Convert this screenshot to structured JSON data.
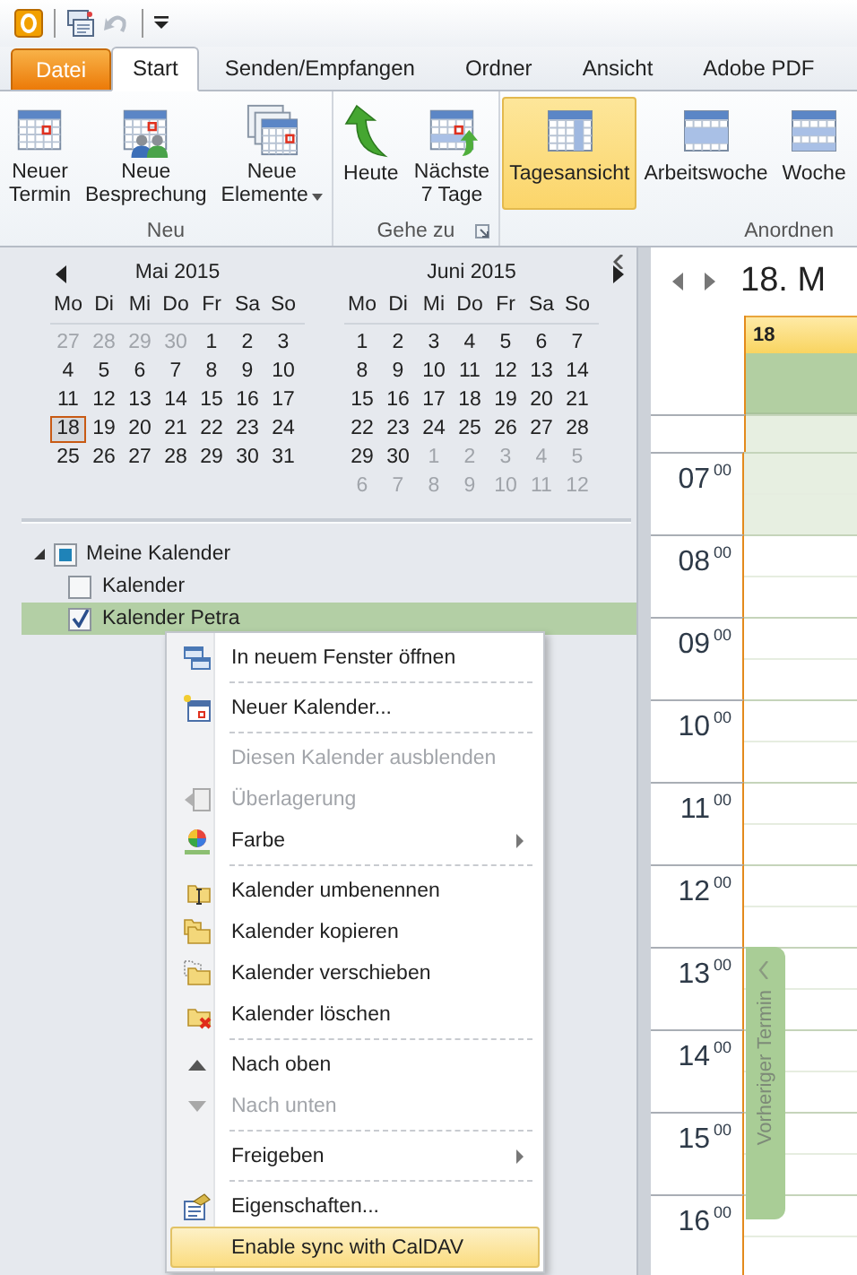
{
  "tabs": [
    {
      "label": "Datei",
      "kind": "file",
      "selected": false
    },
    {
      "label": "Start",
      "kind": "tab",
      "selected": true
    },
    {
      "label": "Senden/Empfangen",
      "kind": "tab",
      "selected": false
    },
    {
      "label": "Ordner",
      "kind": "tab",
      "selected": false
    },
    {
      "label": "Ansicht",
      "kind": "tab",
      "selected": false
    },
    {
      "label": "Adobe PDF",
      "kind": "tab",
      "selected": false
    }
  ],
  "ribbon": {
    "groups": [
      {
        "label": "Neu",
        "buttons": [
          {
            "lines": [
              "Neuer",
              "Termin"
            ],
            "selected": false
          },
          {
            "lines": [
              "Neue",
              "Besprechung"
            ],
            "selected": false
          },
          {
            "lines": [
              "Neue",
              "Elemente"
            ],
            "dropdown": true,
            "selected": false
          }
        ]
      },
      {
        "label": "Gehe zu",
        "launcher": true,
        "buttons": [
          {
            "lines": [
              "Heute"
            ],
            "selected": false
          },
          {
            "lines": [
              "Nächste",
              "7 Tage"
            ],
            "selected": false
          }
        ]
      },
      {
        "label": "Anordnen",
        "buttons": [
          {
            "lines": [
              "Tagesansicht"
            ],
            "selected": true
          },
          {
            "lines": [
              "Arbeitswoche"
            ],
            "selected": false
          },
          {
            "lines": [
              "Woche"
            ],
            "selected": false
          }
        ]
      }
    ]
  },
  "date_navigator": {
    "months": [
      {
        "title": "Mai 2015",
        "weekdays": [
          "Mo",
          "Di",
          "Mi",
          "Do",
          "Fr",
          "Sa",
          "So"
        ],
        "weeks": [
          [
            {
              "d": "27",
              "other": true,
              "selected": false
            },
            {
              "d": "28",
              "other": true,
              "selected": false
            },
            {
              "d": "29",
              "other": true,
              "selected": false
            },
            {
              "d": "30",
              "other": true,
              "selected": false
            },
            {
              "d": "1",
              "other": false,
              "selected": false
            },
            {
              "d": "2",
              "other": false,
              "selected": false
            },
            {
              "d": "3",
              "other": false,
              "selected": false
            }
          ],
          [
            {
              "d": "4",
              "other": false,
              "selected": false
            },
            {
              "d": "5",
              "other": false,
              "selected": false
            },
            {
              "d": "6",
              "other": false,
              "selected": false
            },
            {
              "d": "7",
              "other": false,
              "selected": false
            },
            {
              "d": "8",
              "other": false,
              "selected": false
            },
            {
              "d": "9",
              "other": false,
              "selected": false
            },
            {
              "d": "10",
              "other": false,
              "selected": false
            }
          ],
          [
            {
              "d": "11",
              "other": false,
              "selected": false
            },
            {
              "d": "12",
              "other": false,
              "selected": false
            },
            {
              "d": "13",
              "other": false,
              "selected": false
            },
            {
              "d": "14",
              "other": false,
              "selected": false
            },
            {
              "d": "15",
              "other": false,
              "selected": false
            },
            {
              "d": "16",
              "other": false,
              "selected": false
            },
            {
              "d": "17",
              "other": false,
              "selected": false
            }
          ],
          [
            {
              "d": "18",
              "other": false,
              "selected": true
            },
            {
              "d": "19",
              "other": false,
              "selected": false
            },
            {
              "d": "20",
              "other": false,
              "selected": false
            },
            {
              "d": "21",
              "other": false,
              "selected": false
            },
            {
              "d": "22",
              "other": false,
              "selected": false
            },
            {
              "d": "23",
              "other": false,
              "selected": false
            },
            {
              "d": "24",
              "other": false,
              "selected": false
            }
          ],
          [
            {
              "d": "25",
              "other": false,
              "selected": false
            },
            {
              "d": "26",
              "other": false,
              "selected": false
            },
            {
              "d": "27",
              "other": false,
              "selected": false
            },
            {
              "d": "28",
              "other": false,
              "selected": false
            },
            {
              "d": "29",
              "other": false,
              "selected": false
            },
            {
              "d": "30",
              "other": false,
              "selected": false
            },
            {
              "d": "31",
              "other": false,
              "selected": false
            }
          ]
        ]
      },
      {
        "title": "Juni 2015",
        "weekdays": [
          "Mo",
          "Di",
          "Mi",
          "Do",
          "Fr",
          "Sa",
          "So"
        ],
        "weeks": [
          [
            {
              "d": "1",
              "other": false,
              "selected": false
            },
            {
              "d": "2",
              "other": false,
              "selected": false
            },
            {
              "d": "3",
              "other": false,
              "selected": false
            },
            {
              "d": "4",
              "other": false,
              "selected": false
            },
            {
              "d": "5",
              "other": false,
              "selected": false
            },
            {
              "d": "6",
              "other": false,
              "selected": false
            },
            {
              "d": "7",
              "other": false,
              "selected": false
            }
          ],
          [
            {
              "d": "8",
              "other": false,
              "selected": false
            },
            {
              "d": "9",
              "other": false,
              "selected": false
            },
            {
              "d": "10",
              "other": false,
              "selected": false
            },
            {
              "d": "11",
              "other": false,
              "selected": false
            },
            {
              "d": "12",
              "other": false,
              "selected": false
            },
            {
              "d": "13",
              "other": false,
              "selected": false
            },
            {
              "d": "14",
              "other": false,
              "selected": false
            }
          ],
          [
            {
              "d": "15",
              "other": false,
              "selected": false
            },
            {
              "d": "16",
              "other": false,
              "selected": false
            },
            {
              "d": "17",
              "other": false,
              "selected": false
            },
            {
              "d": "18",
              "other": false,
              "selected": false
            },
            {
              "d": "19",
              "other": false,
              "selected": false
            },
            {
              "d": "20",
              "other": false,
              "selected": false
            },
            {
              "d": "21",
              "other": false,
              "selected": false
            }
          ],
          [
            {
              "d": "22",
              "other": false,
              "selected": false
            },
            {
              "d": "23",
              "other": false,
              "selected": false
            },
            {
              "d": "24",
              "other": false,
              "selected": false
            },
            {
              "d": "25",
              "other": false,
              "selected": false
            },
            {
              "d": "26",
              "other": false,
              "selected": false
            },
            {
              "d": "27",
              "other": false,
              "selected": false
            },
            {
              "d": "28",
              "other": false,
              "selected": false
            }
          ],
          [
            {
              "d": "29",
              "other": false,
              "selected": false
            },
            {
              "d": "30",
              "other": false,
              "selected": false
            },
            {
              "d": "1",
              "other": true,
              "selected": false
            },
            {
              "d": "2",
              "other": true,
              "selected": false
            },
            {
              "d": "3",
              "other": true,
              "selected": false
            },
            {
              "d": "4",
              "other": true,
              "selected": false
            },
            {
              "d": "5",
              "other": true,
              "selected": false
            }
          ],
          [
            {
              "d": "6",
              "other": true,
              "selected": false
            },
            {
              "d": "7",
              "other": true,
              "selected": false
            },
            {
              "d": "8",
              "other": true,
              "selected": false
            },
            {
              "d": "9",
              "other": true,
              "selected": false
            },
            {
              "d": "10",
              "other": true,
              "selected": false
            },
            {
              "d": "11",
              "other": true,
              "selected": false
            },
            {
              "d": "12",
              "other": true,
              "selected": false
            }
          ]
        ]
      }
    ]
  },
  "calendar_tree": {
    "label": "Meine Kalender",
    "expanded": true,
    "checked": true,
    "children": [
      {
        "label": "Kalender",
        "checked": false,
        "selected": false
      },
      {
        "label": "Kalender Petra",
        "checked": true,
        "selected": true
      }
    ]
  },
  "context_menu": {
    "items": [
      {
        "kind": "item",
        "label": "In neuem Fenster öffnen",
        "disabled": false,
        "submenu": false,
        "highlighted": false
      },
      {
        "kind": "separator"
      },
      {
        "kind": "item",
        "label": "Neuer Kalender...",
        "disabled": false,
        "submenu": false,
        "highlighted": false
      },
      {
        "kind": "separator"
      },
      {
        "kind": "item",
        "label": "Diesen Kalender ausblenden",
        "disabled": true,
        "submenu": false,
        "highlighted": false
      },
      {
        "kind": "item",
        "label": "Überlagerung",
        "disabled": true,
        "submenu": false,
        "highlighted": false
      },
      {
        "kind": "item",
        "label": "Farbe",
        "disabled": false,
        "submenu": true,
        "highlighted": false
      },
      {
        "kind": "separator"
      },
      {
        "kind": "item",
        "label": "Kalender umbenennen",
        "disabled": false,
        "submenu": false,
        "highlighted": false
      },
      {
        "kind": "item",
        "label": "Kalender kopieren",
        "disabled": false,
        "submenu": false,
        "highlighted": false
      },
      {
        "kind": "item",
        "label": "Kalender verschieben",
        "disabled": false,
        "submenu": false,
        "highlighted": false
      },
      {
        "kind": "item",
        "label": "Kalender löschen",
        "disabled": false,
        "submenu": false,
        "highlighted": false
      },
      {
        "kind": "separator"
      },
      {
        "kind": "item",
        "label": "Nach oben",
        "disabled": false,
        "submenu": false,
        "highlighted": false
      },
      {
        "kind": "item",
        "label": "Nach unten",
        "disabled": true,
        "submenu": false,
        "highlighted": false
      },
      {
        "kind": "separator"
      },
      {
        "kind": "item",
        "label": "Freigeben",
        "disabled": false,
        "submenu": true,
        "highlighted": false
      },
      {
        "kind": "separator"
      },
      {
        "kind": "item",
        "label": "Eigenschaften...",
        "disabled": false,
        "submenu": false,
        "highlighted": false
      },
      {
        "kind": "item",
        "label": "Enable sync with CalDAV",
        "disabled": false,
        "submenu": false,
        "highlighted": true
      }
    ]
  },
  "day_view": {
    "title": "18. M",
    "day_header": "18",
    "previous_appointment": "Vorheriger Termin",
    "hours": [
      "07$^{00}$",
      "08$^{00}$",
      "09$^{00}$",
      "10$^{00}$",
      "11$^{00}$",
      "12$^{00}$",
      "13$^{00}$",
      "14$^{00}$",
      "15$^{00}$",
      "16$^{00}$"
    ]
  }
}
